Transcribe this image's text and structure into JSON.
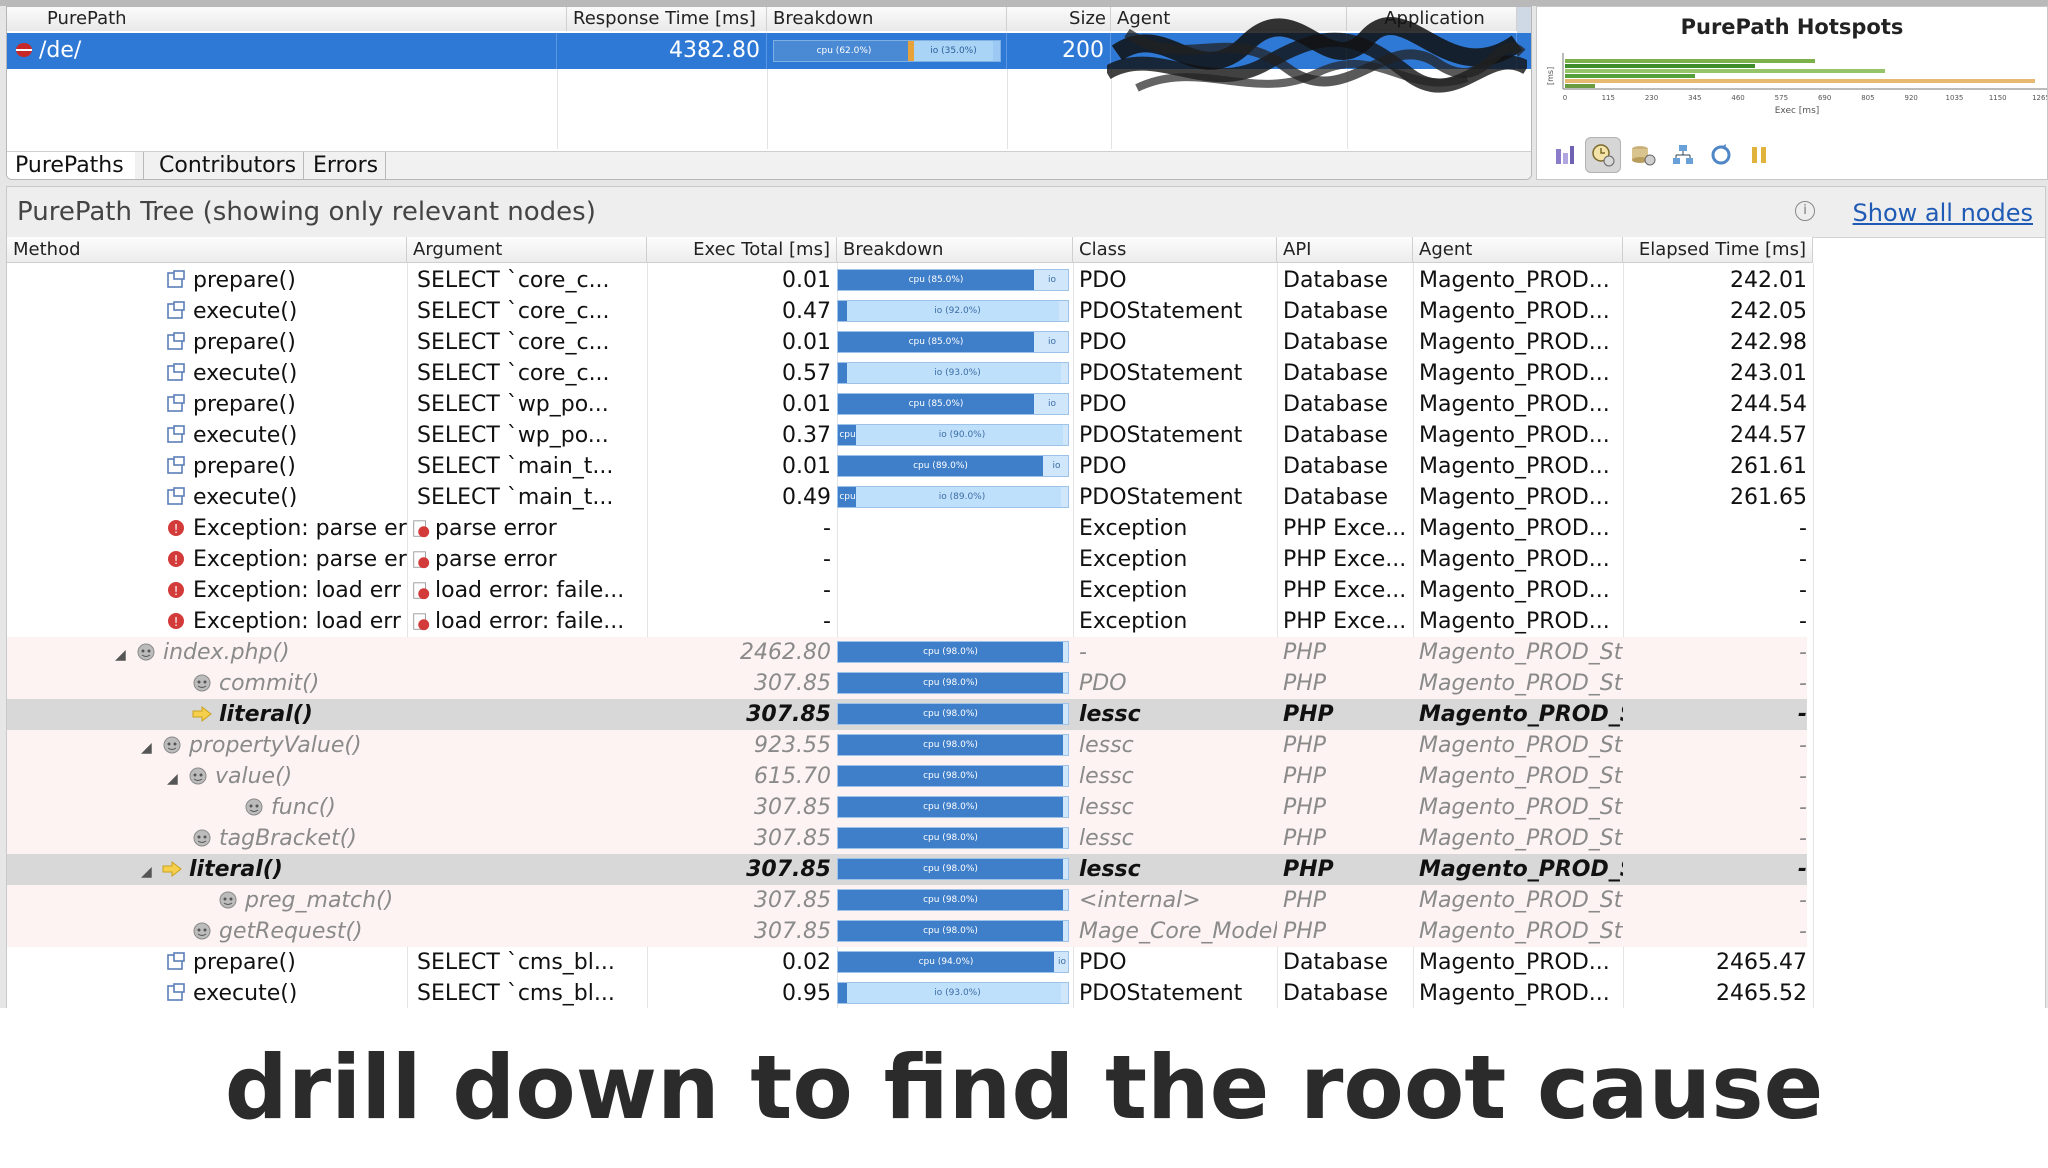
{
  "purepaths": {
    "columns": [
      "PurePath",
      "Response Time [ms]",
      "Breakdown",
      "Size",
      "Agent",
      "Application"
    ],
    "row": {
      "path": "/de/",
      "response_time": "4382.80",
      "cpu_label": "cpu (62.0%)",
      "io_label": "io (35.0%)",
      "cpu_pct": 62,
      "io_pct": 35,
      "size": "200"
    },
    "tabs": [
      "PurePaths",
      "Contributors",
      "Errors"
    ]
  },
  "hotspots": {
    "title": "PurePath Hotspots",
    "ylabel": "[ms]",
    "xlabel": "Exec [ms]",
    "xticks": [
      "0",
      "115",
      "230",
      "345",
      "460",
      "575",
      "690",
      "805",
      "920",
      "1035",
      "1150",
      "1265"
    ],
    "toolbar": [
      "chart-bars-icon",
      "clock-icon",
      "database-icon",
      "hierarchy-icon",
      "refresh-icon",
      "pause-icon"
    ]
  },
  "tree": {
    "title": "PurePath Tree (showing only relevant nodes)",
    "show_all": "Show all nodes",
    "columns": [
      "Method",
      "Argument",
      "Exec Total [ms]",
      "Breakdown",
      "Class",
      "API",
      "Agent",
      "Elapsed Time [ms]"
    ],
    "rows": [
      {
        "method": "prepare()",
        "argument": "SELECT `core_c...",
        "exec": "0.01",
        "bd": {
          "cpu": 85,
          "io": 0,
          "text": "cpu (85.0%)",
          "tag": "io"
        },
        "class": "PDO",
        "api": "Database",
        "agent": "Magento_PROD...",
        "elapsed": "242.01",
        "icon": "method",
        "style": "normal",
        "indent": 0
      },
      {
        "method": "execute()",
        "argument": "SELECT `core_c...",
        "exec": "0.47",
        "bd": {
          "cpu": 4,
          "io": 92,
          "text": "io (92.0%)",
          "tag": ""
        },
        "class": "PDOStatement",
        "api": "Database",
        "agent": "Magento_PROD...",
        "elapsed": "242.05",
        "icon": "method",
        "style": "normal",
        "indent": 0
      },
      {
        "method": "prepare()",
        "argument": "SELECT `core_c...",
        "exec": "0.01",
        "bd": {
          "cpu": 85,
          "io": 0,
          "text": "cpu (85.0%)",
          "tag": "io"
        },
        "class": "PDO",
        "api": "Database",
        "agent": "Magento_PROD...",
        "elapsed": "242.98",
        "icon": "method",
        "style": "normal",
        "indent": 0
      },
      {
        "method": "execute()",
        "argument": "SELECT `core_c...",
        "exec": "0.57",
        "bd": {
          "cpu": 4,
          "io": 93,
          "text": "io (93.0%)",
          "tag": ""
        },
        "class": "PDOStatement",
        "api": "Database",
        "agent": "Magento_PROD...",
        "elapsed": "243.01",
        "icon": "method",
        "style": "normal",
        "indent": 0
      },
      {
        "method": "prepare()",
        "argument": "SELECT `wp_po...",
        "exec": "0.01",
        "bd": {
          "cpu": 85,
          "io": 0,
          "text": "cpu (85.0%)",
          "tag": "io"
        },
        "class": "PDO",
        "api": "Database",
        "agent": "Magento_PROD...",
        "elapsed": "244.54",
        "icon": "method",
        "style": "normal",
        "indent": 0
      },
      {
        "method": "execute()",
        "argument": "SELECT `wp_po...",
        "exec": "0.37",
        "bd": {
          "cpu": 8,
          "io": 90,
          "text": "io (90.0%)",
          "tag": "cpu"
        },
        "class": "PDOStatement",
        "api": "Database",
        "agent": "Magento_PROD...",
        "elapsed": "244.57",
        "icon": "method",
        "style": "normal",
        "indent": 0
      },
      {
        "method": "prepare()",
        "argument": "SELECT `main_t...",
        "exec": "0.01",
        "bd": {
          "cpu": 89,
          "io": 0,
          "text": "cpu (89.0%)",
          "tag": "io"
        },
        "class": "PDO",
        "api": "Database",
        "agent": "Magento_PROD...",
        "elapsed": "261.61",
        "icon": "method",
        "style": "normal",
        "indent": 0
      },
      {
        "method": "execute()",
        "argument": "SELECT `main_t...",
        "exec": "0.49",
        "bd": {
          "cpu": 8,
          "io": 89,
          "text": "io (89.0%)",
          "tag": "cpu"
        },
        "class": "PDOStatement",
        "api": "Database",
        "agent": "Magento_PROD...",
        "elapsed": "261.65",
        "icon": "method",
        "style": "normal",
        "indent": 0
      },
      {
        "method": "Exception: parse er",
        "argument": "parse error",
        "exec": "-",
        "bd": null,
        "class": "Exception",
        "api": "PHP Exce...",
        "agent": "Magento_PROD...",
        "elapsed": "-",
        "icon": "exception",
        "style": "normal",
        "indent": 0
      },
      {
        "method": "Exception: parse er",
        "argument": "parse error",
        "exec": "-",
        "bd": null,
        "class": "Exception",
        "api": "PHP Exce...",
        "agent": "Magento_PROD...",
        "elapsed": "-",
        "icon": "exception",
        "style": "normal",
        "indent": 0
      },
      {
        "method": "Exception: load err",
        "argument": "load error: faile...",
        "exec": "-",
        "bd": null,
        "class": "Exception",
        "api": "PHP Exce...",
        "agent": "Magento_PROD...",
        "elapsed": "-",
        "icon": "exception",
        "style": "normal",
        "indent": 0
      },
      {
        "method": "Exception: load err",
        "argument": "load error: faile...",
        "exec": "-",
        "bd": null,
        "class": "Exception",
        "api": "PHP Exce...",
        "agent": "Magento_PROD...",
        "elapsed": "-",
        "icon": "exception",
        "style": "normal",
        "indent": 0
      },
      {
        "method": "index.php()",
        "argument": "",
        "exec": "2462.80",
        "bd": {
          "cpu": 98,
          "io": 0,
          "text": "cpu (98.0%)",
          "tag": ""
        },
        "class": "-",
        "api": "PHP",
        "agent": "Magento_PROD_St",
        "elapsed": "-",
        "icon": "php",
        "style": "dim",
        "indent": -1,
        "expand": true
      },
      {
        "method": "commit()",
        "argument": "",
        "exec": "307.85",
        "bd": {
          "cpu": 98,
          "io": 0,
          "text": "cpu (98.0%)",
          "tag": ""
        },
        "class": "PDO",
        "api": "PHP",
        "agent": "Magento_PROD_St",
        "elapsed": "-",
        "icon": "php",
        "style": "dim",
        "indent": 1
      },
      {
        "method": "literal()",
        "argument": "",
        "exec": "307.85",
        "bd": {
          "cpu": 98,
          "io": 0,
          "text": "cpu (98.0%)",
          "tag": ""
        },
        "class": "lessc",
        "api": "PHP",
        "agent": "Magento_PROD_St",
        "elapsed": "-",
        "icon": "hotspot",
        "style": "hl",
        "indent": 1
      },
      {
        "method": "propertyValue()",
        "argument": "",
        "exec": "923.55",
        "bd": {
          "cpu": 98,
          "io": 0,
          "text": "cpu (98.0%)",
          "tag": ""
        },
        "class": "lessc",
        "api": "PHP",
        "agent": "Magento_PROD_St",
        "elapsed": "-",
        "icon": "php",
        "style": "dim",
        "indent": 0,
        "expand": true
      },
      {
        "method": "value()",
        "argument": "",
        "exec": "615.70",
        "bd": {
          "cpu": 98,
          "io": 0,
          "text": "cpu (98.0%)",
          "tag": ""
        },
        "class": "lessc",
        "api": "PHP",
        "agent": "Magento_PROD_St",
        "elapsed": "-",
        "icon": "php",
        "style": "dim",
        "indent": 1,
        "expand": true
      },
      {
        "method": "func()",
        "argument": "",
        "exec": "307.85",
        "bd": {
          "cpu": 98,
          "io": 0,
          "text": "cpu (98.0%)",
          "tag": ""
        },
        "class": "lessc",
        "api": "PHP",
        "agent": "Magento_PROD_St",
        "elapsed": "-",
        "icon": "php",
        "style": "dim",
        "indent": 3
      },
      {
        "method": "tagBracket()",
        "argument": "",
        "exec": "307.85",
        "bd": {
          "cpu": 98,
          "io": 0,
          "text": "cpu (98.0%)",
          "tag": ""
        },
        "class": "lessc",
        "api": "PHP",
        "agent": "Magento_PROD_St",
        "elapsed": "-",
        "icon": "php",
        "style": "dim",
        "indent": 1
      },
      {
        "method": "literal()",
        "argument": "",
        "exec": "307.85",
        "bd": {
          "cpu": 98,
          "io": 0,
          "text": "cpu (98.0%)",
          "tag": ""
        },
        "class": "lessc",
        "api": "PHP",
        "agent": "Magento_PROD_St",
        "elapsed": "-",
        "icon": "hotspot",
        "style": "hl",
        "indent": 0,
        "expand": true
      },
      {
        "method": "preg_match()",
        "argument": "",
        "exec": "307.85",
        "bd": {
          "cpu": 98,
          "io": 0,
          "text": "cpu (98.0%)",
          "tag": ""
        },
        "class": "<internal>",
        "api": "PHP",
        "agent": "Magento_PROD_St",
        "elapsed": "-",
        "icon": "php",
        "style": "dim",
        "indent": 2
      },
      {
        "method": "getRequest()",
        "argument": "",
        "exec": "307.85",
        "bd": {
          "cpu": 98,
          "io": 0,
          "text": "cpu (98.0%)",
          "tag": ""
        },
        "class": "Mage_Core_Model",
        "api": "PHP",
        "agent": "Magento_PROD_St",
        "elapsed": "-",
        "icon": "php",
        "style": "dim",
        "indent": 1
      },
      {
        "method": "prepare()",
        "argument": "SELECT `cms_bl...",
        "exec": "0.02",
        "bd": {
          "cpu": 94,
          "io": 0,
          "text": "cpu (94.0%)",
          "tag": "io"
        },
        "class": "PDO",
        "api": "Database",
        "agent": "Magento_PROD...",
        "elapsed": "2465.47",
        "icon": "method",
        "style": "normal",
        "indent": 0
      },
      {
        "method": "execute()",
        "argument": "SELECT `cms_bl...",
        "exec": "0.95",
        "bd": {
          "cpu": 4,
          "io": 93,
          "text": "io (93.0%)",
          "tag": ""
        },
        "class": "PDOStatement",
        "api": "Database",
        "agent": "Magento_PROD...",
        "elapsed": "2465.52",
        "icon": "method",
        "style": "normal",
        "indent": 0
      }
    ]
  },
  "caption": "drill down to find the root cause",
  "colors": {
    "selection": "#2f79d6",
    "cpu": "#3f7fc9",
    "io": "#cfe6fb",
    "link": "#1f5bb5"
  }
}
